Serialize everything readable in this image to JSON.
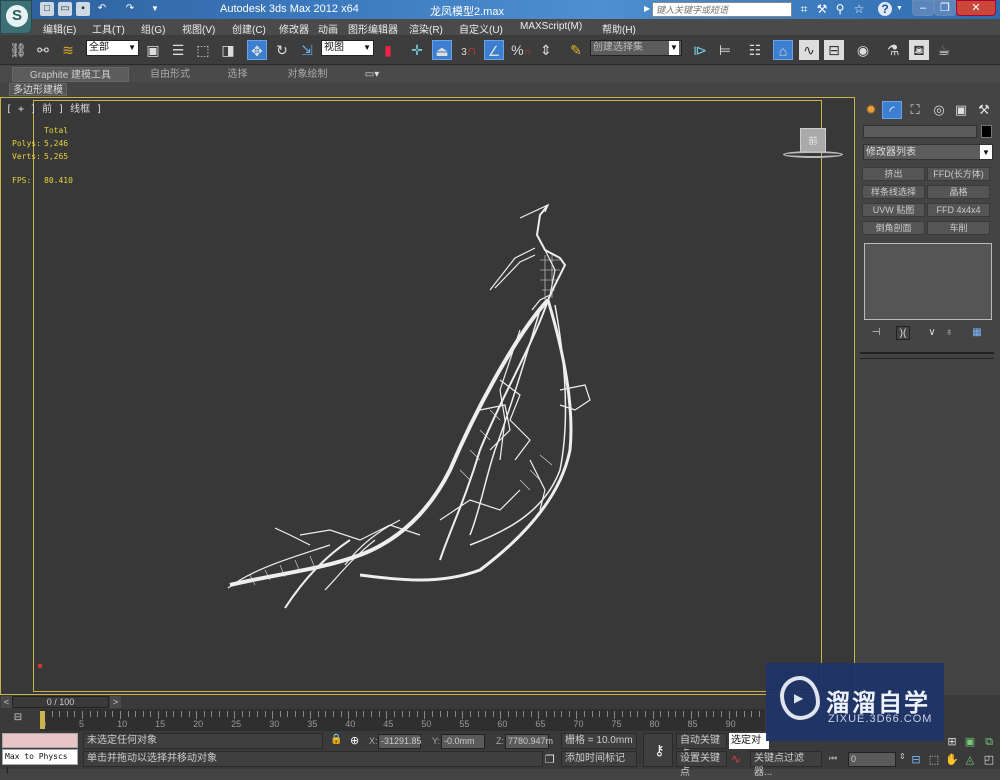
{
  "titlebar": {
    "app_title": "Autodesk 3ds Max  2012 x64",
    "file_name": "龙凤模型2.max",
    "search_placeholder": "键入关键字或短语",
    "quick_access_icons": [
      "new-file-icon",
      "open-file-icon",
      "save-icon",
      "undo-icon",
      "redo-icon",
      "customize-dropdown-icon"
    ],
    "info_icons": [
      "binoculars-icon",
      "wrench-icon",
      "satellite-icon",
      "star-icon",
      "help-icon"
    ],
    "window_buttons": [
      "minimize",
      "restore",
      "close"
    ]
  },
  "menubar": {
    "items": [
      "编辑(E)",
      "工具(T)",
      "组(G)",
      "视图(V)",
      "创建(C)",
      "修改器",
      "动画",
      "图形编辑器",
      "渲染(R)",
      "自定义(U)",
      "MAXScript(M)",
      "帮助(H)"
    ]
  },
  "toolbar": {
    "selection_filter": "全部",
    "reference_coord": "视图",
    "named_selection_placeholder": "创建选择集",
    "snap_label": "3",
    "percent_snap": "%",
    "active_tool": "select-and-move"
  },
  "ribbon": {
    "tabs": [
      "Graphite 建模工具",
      "自由形式",
      "选择",
      "对象绘制"
    ],
    "active_tab": "Graphite 建模工具",
    "panel_label": "多边形建模"
  },
  "viewport": {
    "label": "[ + ] 前 ] 线框 ]",
    "stats": {
      "header": "Total",
      "polys_label": "Polys:",
      "polys_value": "5,246",
      "verts_label": "Verts:",
      "verts_value": "5,265",
      "fps_label": "FPS:",
      "fps_value": "80.410"
    },
    "viewcube_label": "前"
  },
  "command_panel": {
    "tabs": [
      "create-icon",
      "modify-icon",
      "hierarchy-icon",
      "motion-icon",
      "display-icon",
      "utilities-icon"
    ],
    "modifier_list": "修改器列表",
    "modifier_buttons": [
      "挤出",
      "FFD(长方体)",
      "样条线选择",
      "晶格",
      "UVW 贴图",
      "FFD 4x4x4",
      "倒角剖面",
      "车削"
    ],
    "stack_icons": [
      "pin-stack-icon",
      "show-end-result-icon",
      "make-unique-icon",
      "remove-modifier-icon",
      "configure-modifier-sets-icon"
    ]
  },
  "timeline": {
    "slider": "0 / 100",
    "prev": "<",
    "next": ">",
    "ticks": [
      "0",
      "5",
      "10",
      "15",
      "20",
      "25",
      "30",
      "35",
      "40",
      "45",
      "50",
      "55",
      "60",
      "65",
      "70",
      "75",
      "80",
      "85",
      "90"
    ],
    "current_frame_fraction": 0
  },
  "status": {
    "script_listener": "Max to Physcs (",
    "selection_status": "未选定任何对象",
    "prompt": "单击并拖动以选择并移动对象",
    "x_label": "X:",
    "x_value": "-31291.85",
    "y_label": "Y:",
    "y_value": "-0.0mm",
    "z_label": "Z:",
    "z_value": "7780.947m",
    "grid": "栅格 = 10.0mm",
    "add_time_tag": "添加时间标记",
    "auto_key": "自动关键点",
    "set_key": "设置关键点",
    "selected_dropdown": "选定对象",
    "key_filters": "关键点过滤器...",
    "frame_value": "0"
  },
  "watermark": {
    "title": "溜溜自学",
    "url": "ZIXUE.3D66.COM"
  },
  "colors": {
    "accent_blue": "#3c7fd0",
    "viewport_border": "#c8b44a",
    "stats_yellow": "#e6d438",
    "viewport_bg": "#383838",
    "watermark_bg": "#1f3566"
  }
}
